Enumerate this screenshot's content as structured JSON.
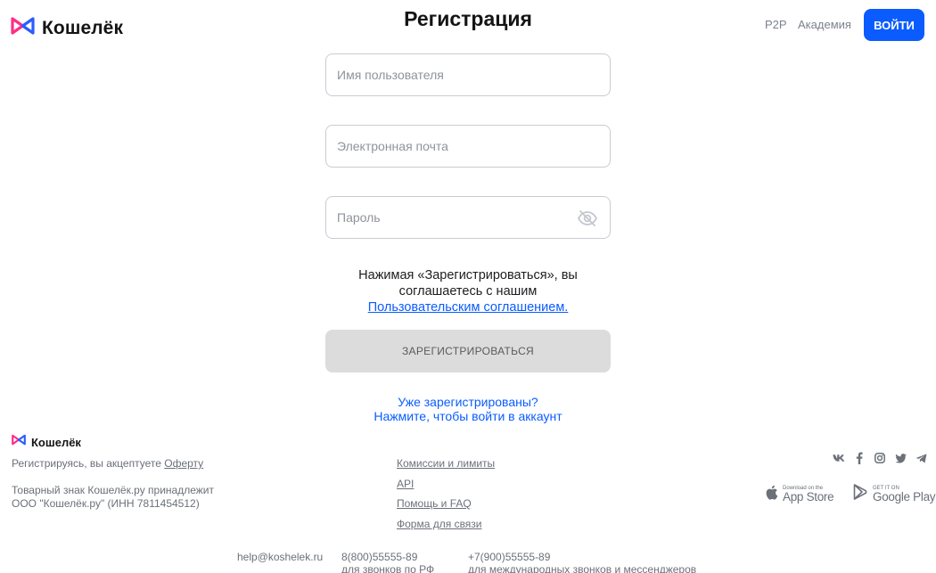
{
  "header": {
    "brand": "Кошелёк",
    "page_title": "Регистрация",
    "nav": {
      "p2p": "P2P",
      "academy": "Академия"
    },
    "login_label": "ВОЙТИ"
  },
  "form": {
    "username_placeholder": "Имя пользователя",
    "email_placeholder": "Электронная почта",
    "password_placeholder": "Пароль",
    "agree_line1": "Нажимая «Зарегистрироваться», вы",
    "agree_line2": "соглашаетесь с нашим",
    "agree_link": "Пользовательским соглашением.",
    "register_label": "ЗАРЕГИСТРИРОВАТЬСЯ",
    "already_line1": "Уже зарегистрированы?",
    "already_line2": "Нажмите, чтобы войти в аккаунт"
  },
  "footer": {
    "brand": "Кошелёк",
    "offer_text": "Регистрируясь, вы акцептуете",
    "offer_link": "Оферту",
    "trademark_line1": "Товарный знак Кошелёк.ру принадлежит",
    "trademark_line2": "ООО \"Кошелёк.ру\" (ИНН 7811454512)",
    "links": [
      "Комиссии и лимиты",
      "API",
      "Помощь и FAQ",
      "Форма для связи"
    ],
    "social_icons": [
      "vk-icon",
      "facebook-icon",
      "instagram-icon",
      "twitter-icon",
      "telegram-icon"
    ],
    "app_store": {
      "small": "Download on the",
      "big": "App Store"
    },
    "google_play": {
      "small": "GET IT ON",
      "big": "Google Play"
    },
    "contacts": {
      "email": "help@koshelek.ru",
      "phone_ru": "8(800)55555-89",
      "phone_ru_note": "для звонков по РФ",
      "phone_intl": "+7(900)55555-89",
      "phone_intl_note": "для международных звонков и мессенджеров"
    }
  },
  "colors": {
    "accent": "#0a5cff",
    "logo_pink": "#ff2d87",
    "logo_blue": "#2b5cff",
    "muted": "#6b7079"
  }
}
